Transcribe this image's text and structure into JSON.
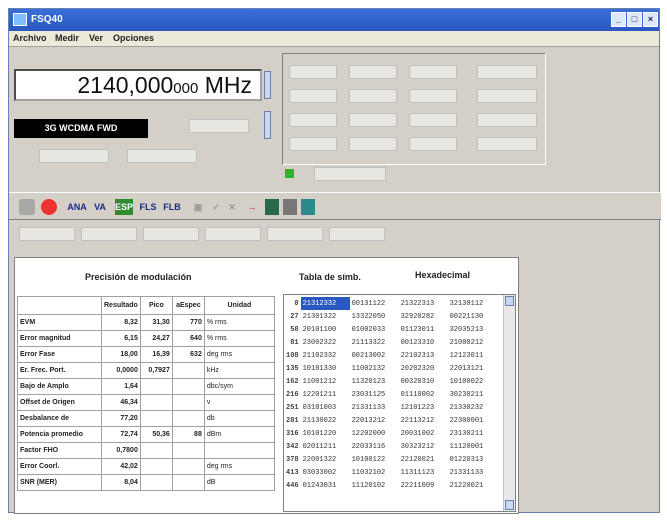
{
  "window": {
    "title": "FSQ40"
  },
  "menu": [
    "Archivo",
    "Medir",
    "Ver",
    "Opciones"
  ],
  "frequency": {
    "value": "2140,000",
    "fraction": "000",
    "unit": "MHz"
  },
  "mode": {
    "label": "3G WCDMA FWD"
  },
  "toolbar": {
    "items": [
      "ANA",
      "VA",
      "ESP",
      "FLS",
      "FLB"
    ]
  },
  "modulation": {
    "title": "Precisión de modulación",
    "headers": [
      "Resultado",
      "Pico",
      "aEspec",
      "Unidad"
    ],
    "rows": [
      {
        "label": "EVM",
        "result": "8,32",
        "peak": "31,30",
        "spec": "770",
        "unit": "% rms"
      },
      {
        "label": "Error magnitud",
        "result": "6,15",
        "peak": "24,27",
        "spec": "640",
        "unit": "% rms"
      },
      {
        "label": "Error Fase",
        "result": "18,00",
        "peak": "16,39",
        "spec": "632",
        "unit": "deg rms"
      },
      {
        "label": "Er. Frec. Port.",
        "result": "0,0000",
        "peak": "0,7927",
        "spec": "",
        "unit": "kHz"
      },
      {
        "label": "Bajo de Amplo",
        "result": "1,64",
        "peak": "",
        "spec": "",
        "unit": "dbc/sym"
      },
      {
        "label": "Offset de Origen",
        "result": "46,34",
        "peak": "",
        "spec": "",
        "unit": "ν"
      },
      {
        "label": "Desbalance de",
        "result": "77,20",
        "peak": "",
        "spec": "",
        "unit": "db"
      },
      {
        "label": "Potencia promedio",
        "result": "72,74",
        "peak": "50,36",
        "spec": "88",
        "unit": "dBm"
      },
      {
        "label": "Factor FHO",
        "result": "0,7800",
        "peak": "",
        "spec": "",
        "unit": ""
      },
      {
        "label": "Error Coorl.",
        "result": "42,02",
        "peak": "",
        "spec": "",
        "unit": "deg rms"
      },
      {
        "label": "SNR (MER)",
        "result": "8,04",
        "peak": "",
        "spec": "",
        "unit": "dB"
      }
    ]
  },
  "symbols": {
    "title": "Tabla de símb.",
    "format": "Hexadecimal",
    "rows": [
      {
        "idx": "0",
        "c": [
          "21312332",
          "00131122",
          "21322313",
          "32130112"
        ]
      },
      {
        "idx": "27",
        "c": [
          "21301322",
          "13322050",
          "32920282",
          "00221130"
        ]
      },
      {
        "idx": "58",
        "c": [
          "20101100",
          "01002033",
          "01123011",
          "32035213"
        ]
      },
      {
        "idx": "81",
        "c": [
          "23002322",
          "21113322",
          "00123310",
          "21000212"
        ]
      },
      {
        "idx": "108",
        "c": [
          "21102332",
          "00213002",
          "22102313",
          "12123011"
        ]
      },
      {
        "idx": "135",
        "c": [
          "10101330",
          "11002132",
          "20202320",
          "22013121"
        ]
      },
      {
        "idx": "162",
        "c": [
          "11001212",
          "11320123",
          "00320310",
          "10100022"
        ]
      },
      {
        "idx": "216",
        "c": [
          "12201211",
          "23031125",
          "01110002",
          "30230211"
        ]
      },
      {
        "idx": "251",
        "c": [
          "03101003",
          "21331133",
          "12101223",
          "21330232"
        ]
      },
      {
        "idx": "281",
        "c": [
          "21130022",
          "22013212",
          "22113212",
          "22300001"
        ]
      },
      {
        "idx": "316",
        "c": [
          "10101220",
          "12202000",
          "20031002",
          "23130211"
        ]
      },
      {
        "idx": "342",
        "c": [
          "02011211",
          "22033116",
          "30323212",
          "11120001"
        ]
      },
      {
        "idx": "378",
        "c": [
          "22001322",
          "10100122",
          "22120021",
          "01220313"
        ]
      },
      {
        "idx": "413",
        "c": [
          "03033002",
          "11032102",
          "11311123",
          "21331133"
        ]
      },
      {
        "idx": "446",
        "c": [
          "01243031",
          "11120102",
          "22211009",
          "21220021"
        ]
      }
    ]
  }
}
